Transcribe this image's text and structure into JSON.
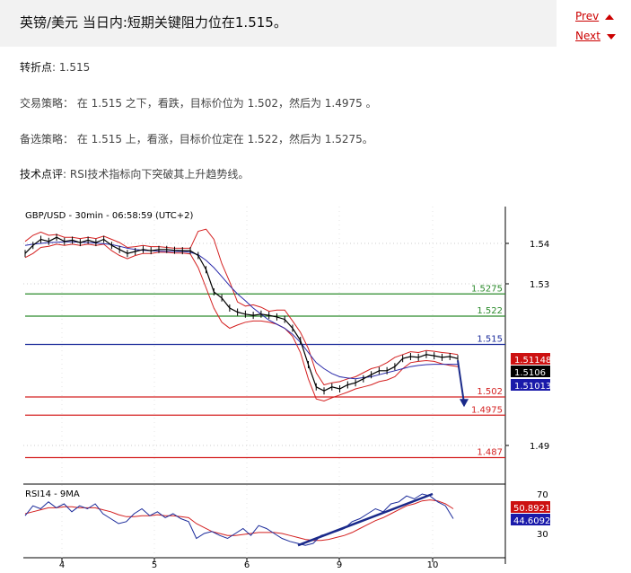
{
  "header": {
    "title": "英镑/美元 当日内:短期关键阻力位在1.515。",
    "prev_label": "Prev",
    "next_label": "Next"
  },
  "article": {
    "pivot_label": "转折点",
    "pivot_value": ": 1.515",
    "strategy": "交易策略： 在 1.515 之下，看跌，目标价位为 1.502，然后为 1.4975 。",
    "alternative": "备选策略： 在 1.515 上，看涨，目标价位定在 1.522，然后为 1.5275。",
    "comment_label": "技术点评",
    "comment_text": ": RSI技术指标向下突破其上升趋势线。"
  },
  "chart_data": {
    "type": "line",
    "title": "GBP/USD - 30min - 06:58:59 (UTC+2)",
    "x_ticks": [
      "4",
      "5",
      "6",
      "9",
      "10"
    ],
    "price_axis": {
      "ticks": [
        "1.54",
        "1.53",
        "1.49"
      ],
      "ylim": [
        1.484,
        1.5445
      ]
    },
    "levels": [
      {
        "value": 1.5275,
        "label": "1.5275",
        "color": "#2a8a2a"
      },
      {
        "value": 1.522,
        "label": "1.522",
        "color": "#2a8a2a"
      },
      {
        "value": 1.515,
        "label": "1.515",
        "color": "#1a2a9a"
      },
      {
        "value": 1.502,
        "label": "1.502",
        "color": "#d42020"
      },
      {
        "value": 1.4975,
        "label": "1.4975",
        "color": "#d42020"
      },
      {
        "value": 1.487,
        "label": "1.487",
        "color": "#d42020"
      }
    ],
    "price_badges": [
      {
        "label": "1.51148",
        "color": "#cc1111"
      },
      {
        "label": "1.5106",
        "color": "#000000"
      },
      {
        "label": "1.51013",
        "color": "#1a1aaa"
      }
    ],
    "price_series": [
      1.5375,
      1.5395,
      1.541,
      1.5405,
      1.5415,
      1.5405,
      1.5408,
      1.5402,
      1.5408,
      1.5402,
      1.541,
      1.5395,
      1.5385,
      1.5375,
      1.538,
      1.5385,
      1.5382,
      1.5385,
      1.5385,
      1.5383,
      1.5382,
      1.5382,
      1.537,
      1.5335,
      1.528,
      1.5265,
      1.524,
      1.523,
      1.5225,
      1.5222,
      1.5225,
      1.5222,
      1.5218,
      1.5212,
      1.519,
      1.516,
      1.51,
      1.5045,
      1.5035,
      1.5045,
      1.504,
      1.505,
      1.5055,
      1.5065,
      1.5075,
      1.5085,
      1.5085,
      1.5095,
      1.5115,
      1.512,
      1.5118,
      1.5125,
      1.5122,
      1.5118,
      1.512,
      1.5115
    ],
    "bb_upper": [
      1.5405,
      1.542,
      1.5428,
      1.542,
      1.5422,
      1.5415,
      1.5415,
      1.5412,
      1.5415,
      1.5412,
      1.5418,
      1.541,
      1.5402,
      1.539,
      1.5392,
      1.5395,
      1.5392,
      1.5392,
      1.539,
      1.5388,
      1.5388,
      1.5388,
      1.543,
      1.5435,
      1.541,
      1.535,
      1.5305,
      1.5255,
      1.5245,
      1.5248,
      1.5242,
      1.5232,
      1.5235,
      1.5235,
      1.5208,
      1.518,
      1.514,
      1.508,
      1.505,
      1.5055,
      1.5058,
      1.5065,
      1.507,
      1.508,
      1.509,
      1.5095,
      1.5105,
      1.5118,
      1.5125,
      1.5132,
      1.513,
      1.5135,
      1.5133,
      1.513,
      1.5128,
      1.5125
    ],
    "bb_lower": [
      1.5365,
      1.5375,
      1.539,
      1.5393,
      1.5398,
      1.5395,
      1.5398,
      1.5395,
      1.5398,
      1.5395,
      1.5398,
      1.5382,
      1.537,
      1.5362,
      1.537,
      1.5375,
      1.5375,
      1.5378,
      1.5378,
      1.5376,
      1.5376,
      1.5374,
      1.534,
      1.529,
      1.524,
      1.5205,
      1.519,
      1.5198,
      1.5205,
      1.5208,
      1.5208,
      1.5205,
      1.52,
      1.519,
      1.517,
      1.513,
      1.5065,
      1.5015,
      1.501,
      1.5018,
      1.5025,
      1.5032,
      1.504,
      1.5045,
      1.505,
      1.5058,
      1.5062,
      1.507,
      1.509,
      1.5105,
      1.5108,
      1.511,
      1.5108,
      1.5102,
      1.5098,
      1.5095
    ],
    "ma_series": [
      1.5395,
      1.5398,
      1.54,
      1.5402,
      1.5403,
      1.5404,
      1.5404,
      1.5403,
      1.5402,
      1.5401,
      1.5399,
      1.5397,
      1.5393,
      1.5388,
      1.5385,
      1.5383,
      1.5382,
      1.5381,
      1.538,
      1.538,
      1.538,
      1.5378,
      1.5372,
      1.5358,
      1.534,
      1.5318,
      1.5295,
      1.5275,
      1.5258,
      1.524,
      1.5225,
      1.521,
      1.52,
      1.519,
      1.5175,
      1.5155,
      1.513,
      1.5105,
      1.509,
      1.5078,
      1.507,
      1.5067,
      1.5065,
      1.5068,
      1.507,
      1.5075,
      1.508,
      1.5085,
      1.509,
      1.5095,
      1.5098,
      1.51,
      1.5101,
      1.5101,
      1.5101,
      1.5101
    ],
    "rsi_panel": {
      "label": "RSI14 - 9MA",
      "ticks": [
        "70",
        "30"
      ],
      "ylim": [
        10,
        78
      ],
      "badges": [
        {
          "label": "50.8921",
          "color": "#cc1111"
        },
        {
          "label": "44.6092",
          "color": "#1a1aaa"
        }
      ],
      "rsi": [
        48,
        58,
        55,
        62,
        56,
        60,
        52,
        58,
        55,
        60,
        50,
        45,
        40,
        42,
        50,
        55,
        48,
        52,
        46,
        50,
        45,
        42,
        25,
        30,
        32,
        28,
        25,
        30,
        35,
        28,
        38,
        35,
        30,
        25,
        22,
        20,
        18,
        20,
        28,
        30,
        32,
        35,
        42,
        45,
        50,
        55,
        52,
        60,
        62,
        68,
        65,
        70,
        68,
        62,
        58,
        45
      ],
      "ma": [
        50,
        52,
        54,
        56,
        56,
        57,
        57,
        56,
        56,
        56,
        54,
        52,
        49,
        47,
        47,
        48,
        48,
        49,
        48,
        48,
        47,
        46,
        40,
        36,
        32,
        30,
        28,
        28,
        29,
        30,
        31,
        31,
        31,
        30,
        28,
        26,
        24,
        23,
        23,
        24,
        26,
        28,
        31,
        35,
        39,
        43,
        46,
        50,
        54,
        58,
        60,
        63,
        64,
        63,
        60,
        55
      ]
    }
  }
}
